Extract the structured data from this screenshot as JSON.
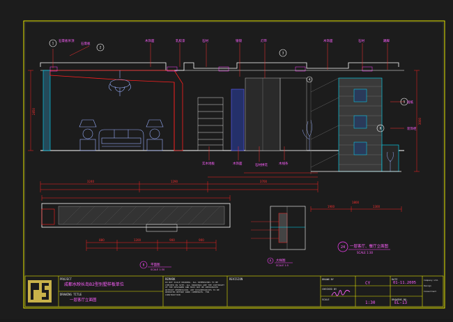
{
  "colors": {
    "background": "#1c1c1c",
    "frame": "#e8e800",
    "wall": "#ffffff",
    "dimension": "#ff2020",
    "leader": "#ff3030",
    "annotation": "#ff60ff",
    "furniture": "#9ab0ff",
    "cabinet_fill": "#3a3a3a",
    "cyan": "#00e0ff",
    "magenta": "#ff40ff",
    "logo": "#c9b24a"
  },
  "icons": {
    "logo": "interlocking-square-logo",
    "section_marker": "circle-callout-icon"
  },
  "callouts": {
    "c1": "1",
    "c2": "2",
    "c3": "3",
    "c4": "4",
    "c5": "5",
    "c6": "6"
  },
  "notes": {
    "note_top_1": "石膏板吊顶",
    "note_top_2": "石膏板",
    "note_top_3": "木饰面",
    "note_top_4": "乳胶漆",
    "note_top_5": "石材",
    "note_top_6": "银镜",
    "note_top_7": "灯带",
    "note_top_8": "木饰面",
    "note_top_9": "石材",
    "note_top_10": "踢脚",
    "note_mid_1": "实木地板",
    "note_mid_2": "木饰面",
    "note_mid_3": "石材拼花",
    "note_mid_4": "木线条",
    "note_right_1": "墙纸",
    "note_right_2": "装饰柜"
  },
  "dims": {
    "d_main_1": "3240",
    "d_main_2": "1290",
    "d_main_3": "3700",
    "d_sub_1": "880",
    "d_sub_2": "1200",
    "d_sub_3": "900",
    "d_sub_4": "900",
    "d_right_1": "1900",
    "d_right_2": "1300",
    "d_right_3": "1800",
    "d_vert_1": "2850",
    "d_vert_2": "3000"
  },
  "labels": {
    "elev_marker": "24",
    "elev_title": "一层客厅、餐厅立面图",
    "elev_scale": "SCALE 1:30",
    "plan_marker": "B",
    "plan_title": "平面图",
    "plan_scale": "SCALE 1:30",
    "detail_marker": "A",
    "detail_title": "大样图",
    "detail_scale": "SCALE 1:5"
  },
  "title_block": {
    "project_label": "PROJECT",
    "project_name": "成都水映长岛B2型别墅样板单位",
    "drawing_label": "DRAWING TITLE",
    "drawing_name": "一层客厅立面图",
    "remark_label": "REMARK",
    "remark_text": "DO NOT SCALE DRAWING. ALL DIMENSIONS TO BE CHECKED ON SITE. ALL DRAWINGS ARE THE COPYRIGHT OF THE DESIGNER AND MUST NOT BE REPRODUCED WITHOUT PERMISSION. ANY DISCREPANCIES TO BE REPORTED BEFORE WORK COMMENCES. FOR CONSTRUCTION",
    "revision_label": "REVISION",
    "drawn_label": "DRAWN BY",
    "checked_label": "CHECKED BY",
    "designer": "CY",
    "scale_label": "SCALE",
    "scale_value": "1:30",
    "date_label": "DATE",
    "date_value": "01-11.2005",
    "drawing_no_label": "DRAWING NO.",
    "drawing_no": "EL-13",
    "company_line_1": "Company Ltd.",
    "company_line_2": "Design",
    "company_line_3": "Consultant"
  }
}
